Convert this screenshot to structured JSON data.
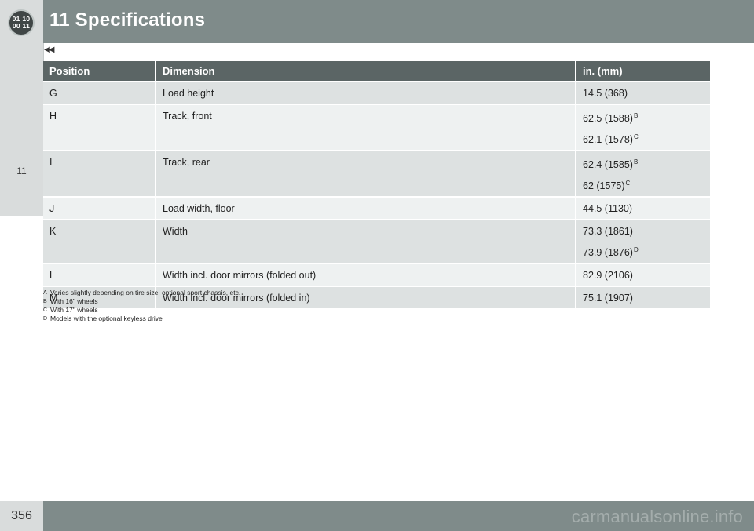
{
  "header": {
    "chapter_icon_lines": [
      "01 10",
      "00 11"
    ],
    "title": "11 Specifications"
  },
  "side_tab": {
    "number": "11"
  },
  "nav": {
    "back_arrows": "◀◀"
  },
  "table": {
    "columns": [
      "Position",
      "Dimension",
      "in. (mm)"
    ],
    "rows": [
      {
        "position": "G",
        "dimension": "Load height",
        "values": [
          {
            "text": "14.5 (368)",
            "note": ""
          }
        ]
      },
      {
        "position": "H",
        "dimension": "Track, front",
        "values": [
          {
            "text": "62.5 (1588)",
            "note": "B"
          },
          {
            "text": "62.1 (1578)",
            "note": "C"
          }
        ]
      },
      {
        "position": "I",
        "dimension": "Track, rear",
        "values": [
          {
            "text": "62.4 (1585)",
            "note": "B"
          },
          {
            "text": "62 (1575)",
            "note": "C"
          }
        ]
      },
      {
        "position": "J",
        "dimension": "Load width, floor",
        "values": [
          {
            "text": "44.5 (1130)",
            "note": ""
          }
        ]
      },
      {
        "position": "K",
        "dimension": "Width",
        "values": [
          {
            "text": "73.3 (1861)",
            "note": ""
          },
          {
            "text": "73.9 (1876)",
            "note": "D"
          }
        ]
      },
      {
        "position": "L",
        "dimension": "Width incl. door mirrors (folded out)",
        "values": [
          {
            "text": "82.9 (2106)",
            "note": ""
          }
        ]
      },
      {
        "position": "M",
        "dimension": "Width incl. door mirrors (folded in)",
        "values": [
          {
            "text": "75.1 (1907)",
            "note": ""
          }
        ]
      }
    ]
  },
  "footnotes": [
    {
      "mark": "A",
      "text": "Varies slightly depending on tire size, optional sport chassis, etc."
    },
    {
      "mark": "B",
      "text": "With 16\" wheels"
    },
    {
      "mark": "C",
      "text": "With 17\" wheels"
    },
    {
      "mark": "D",
      "text": "Models with the optional keyless drive"
    }
  ],
  "footer": {
    "page_number": "356",
    "watermark": "carmanualsonline.info"
  }
}
